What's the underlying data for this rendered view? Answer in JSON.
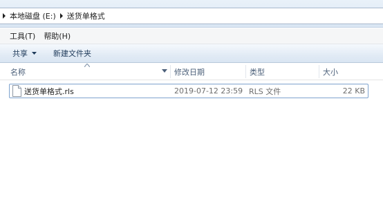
{
  "address": {
    "drive": "本地磁盘 (E:)",
    "folder": "送货单格式"
  },
  "menu": {
    "tools": "工具(T)",
    "help": "帮助(H)"
  },
  "commands": {
    "share": "共享",
    "new_folder": "新建文件夹"
  },
  "columns": {
    "name": "名称",
    "modified": "修改日期",
    "type": "类型",
    "size": "大小"
  },
  "files": [
    {
      "name": "送货单格式.rls",
      "modified": "2019-07-12 23:59",
      "type": "RLS 文件",
      "size": "22 KB"
    }
  ]
}
